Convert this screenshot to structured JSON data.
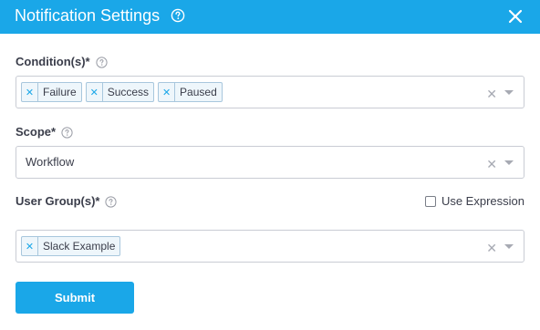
{
  "dialog": {
    "title": "Notification Settings",
    "accent_color": "#1aa7e8"
  },
  "conditions": {
    "label": "Condition(s)*",
    "chips": [
      "Failure",
      "Success",
      "Paused"
    ]
  },
  "scope": {
    "label": "Scope*",
    "value": "Workflow"
  },
  "user_groups": {
    "label": "User Group(s)*",
    "use_expression_label": "Use Expression",
    "use_expression_checked": false,
    "chips": [
      "Slack Example"
    ]
  },
  "actions": {
    "submit_label": "Submit"
  },
  "icons": {
    "help": "help-circle-icon",
    "close": "close-icon",
    "clear": "clear-x-icon",
    "dropdown": "chevron-down-icon",
    "chip_remove": "remove-x-icon"
  }
}
